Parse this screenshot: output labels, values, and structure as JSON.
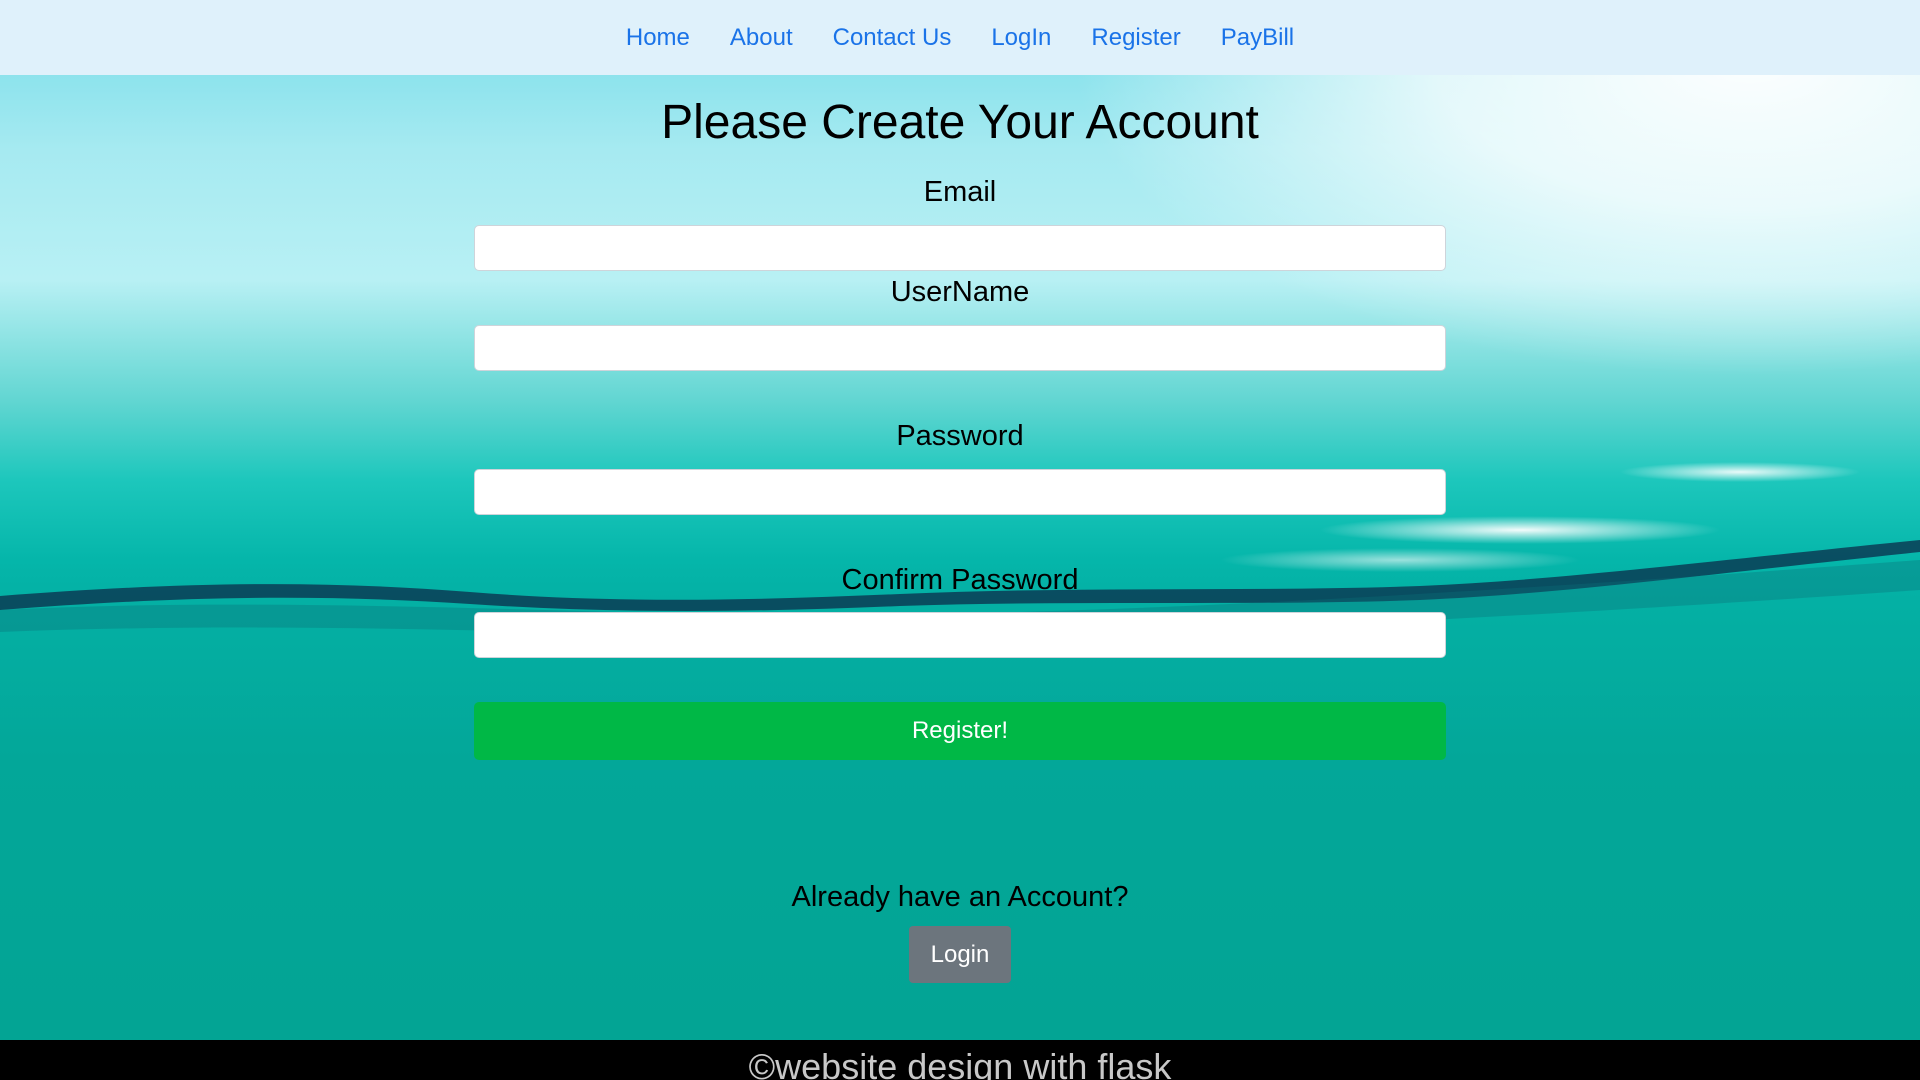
{
  "nav": {
    "items": [
      {
        "label": "Home"
      },
      {
        "label": "About"
      },
      {
        "label": "Contact Us"
      },
      {
        "label": "LogIn"
      },
      {
        "label": "Register"
      },
      {
        "label": "PayBill"
      }
    ]
  },
  "form": {
    "title": "Please Create Your Account",
    "email_label": "Email",
    "email_value": "",
    "username_label": "UserName",
    "username_value": "",
    "password_label": "Password",
    "password_value": "",
    "confirm_label": "Confirm Password",
    "confirm_value": "",
    "submit_label": "Register!"
  },
  "login_prompt": {
    "question": "Already have an Account?",
    "button_label": "Login"
  },
  "footer": {
    "text": "©website design with flask"
  },
  "colors": {
    "nav_background": "#dff1fb",
    "nav_link": "#1a73e8",
    "register_button": "#00b846",
    "login_button": "#6c757d",
    "footer_background": "#000000"
  }
}
